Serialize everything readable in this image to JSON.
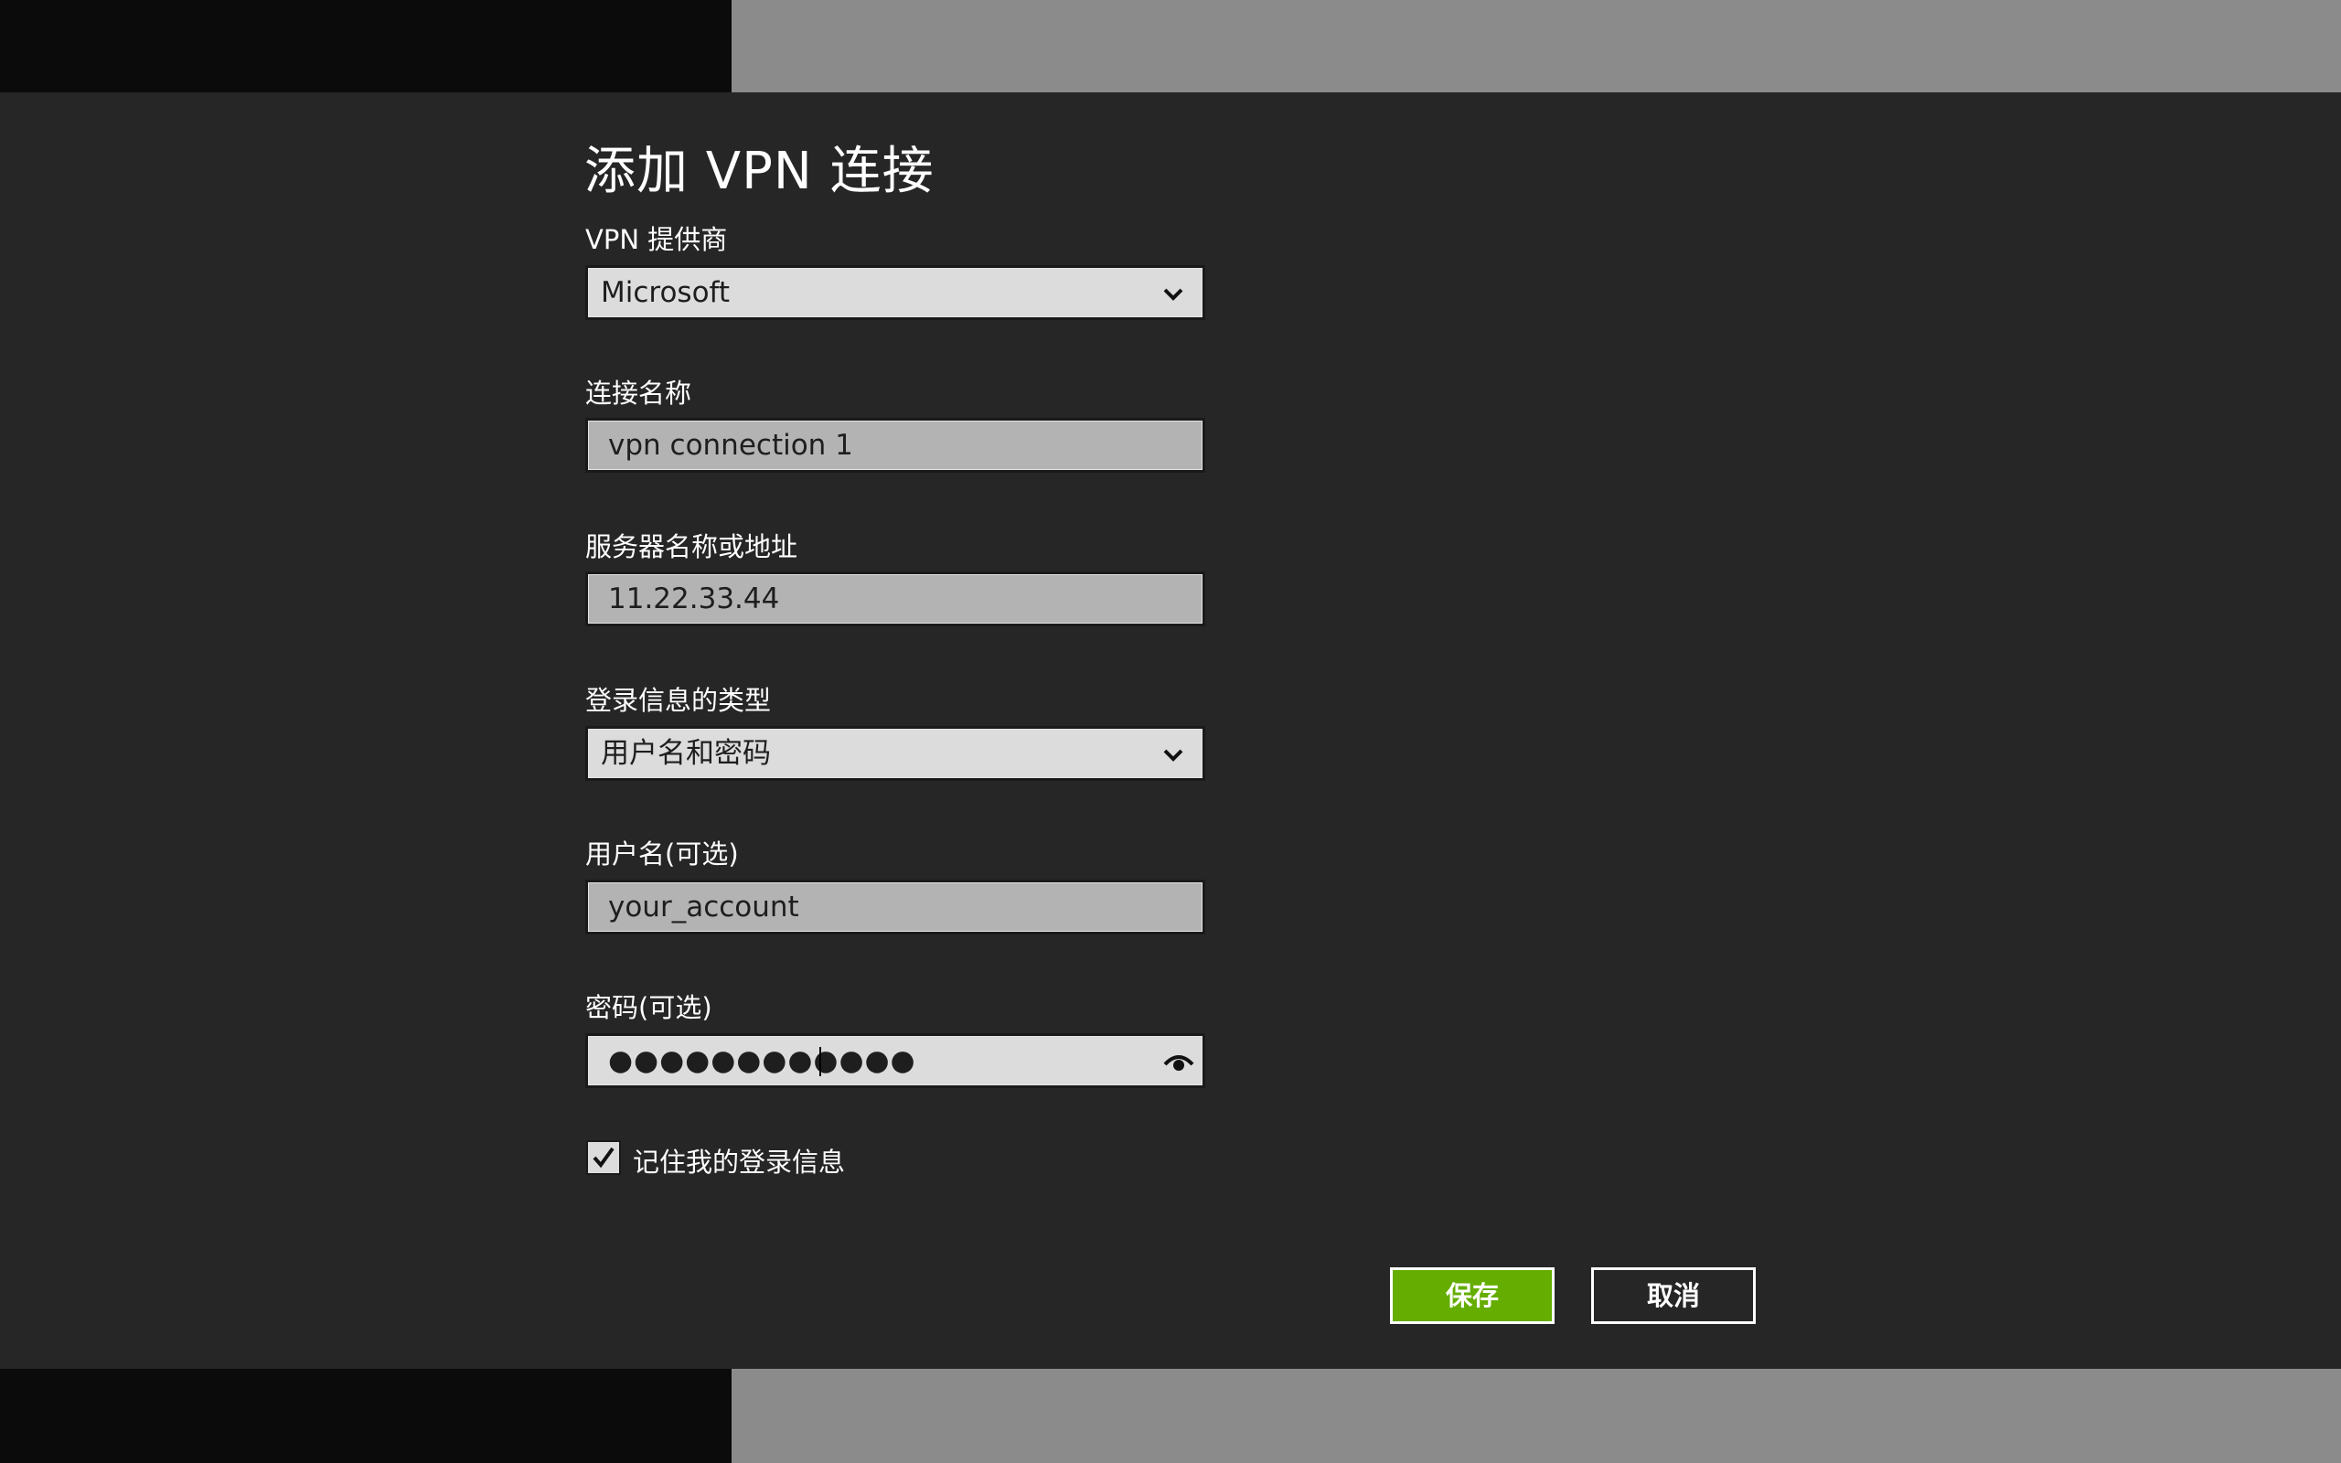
{
  "dialog": {
    "title": "添加 VPN 连接"
  },
  "fields": {
    "provider": {
      "label": "VPN 提供商",
      "value": "Microsoft"
    },
    "connection_name": {
      "label": "连接名称",
      "value": "vpn connection 1"
    },
    "server": {
      "label": "服务器名称或地址",
      "value": "11.22.33.44"
    },
    "signin_type": {
      "label": "登录信息的类型",
      "value": "用户名和密码"
    },
    "username": {
      "label": "用户名(可选)",
      "value": "your_account"
    },
    "password": {
      "label": "密码(可选)",
      "value": "●●●●●●●●●●●●"
    }
  },
  "remember": {
    "label": "记住我的登录信息",
    "checked": true
  },
  "buttons": {
    "save": "保存",
    "cancel": "取消"
  },
  "icons": {
    "dropdown": "chevron-down-icon",
    "reveal": "eye-icon",
    "checked": "checkmark-icon"
  },
  "colors": {
    "dialog_bg": "#262626",
    "accent": "#65ad00",
    "field_bg": "#dcdcdc",
    "field_readonly_bg": "#b3b3b3"
  }
}
